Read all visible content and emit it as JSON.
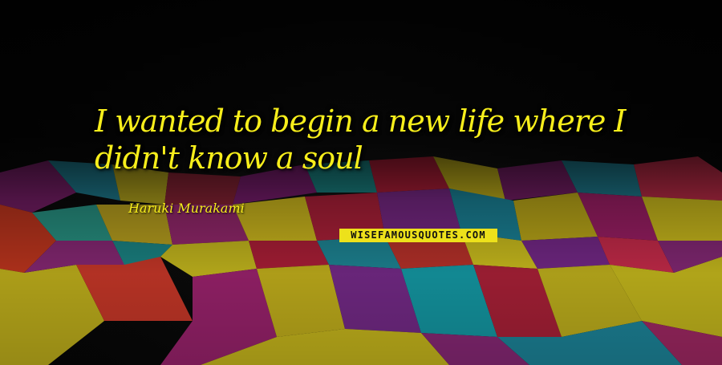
{
  "quote": {
    "line1": "I wanted to begin a new life where I",
    "line2": "didn't know a soul"
  },
  "author": "Haruki Murakami",
  "watermark": "WISEFAMOUSQUOTES.COM",
  "colors": {
    "text": "#f7ee1b",
    "watermark_bg": "#ede11b",
    "background": "#0c0c0c"
  }
}
